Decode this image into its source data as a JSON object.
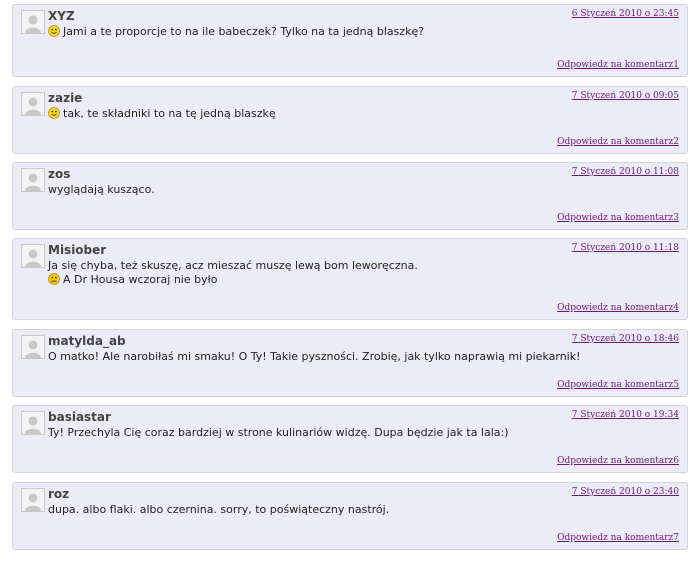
{
  "comments": [
    {
      "author": "XYZ",
      "date": "6 Styczeń 2010 o 23:45",
      "smiley1": "happy-smiley-icon",
      "line1": "Jami a te proporcje to na ile babeczek? Tylko na ta jedną blaszkę?",
      "line2": "",
      "reply": "Odpowiedz na komentarz1"
    },
    {
      "author": "zazie",
      "date": "7 Styczeń 2010 o 09:05",
      "smiley1": "happy-smiley-icon",
      "line1": "tak, te składniki to na tę jedną blaszkę",
      "line2": "",
      "reply": "Odpowiedz na komentarz2"
    },
    {
      "author": "zos",
      "date": "7 Styczeń 2010 o 11:08",
      "line1": "wyglądają kusząco.",
      "line2": "",
      "reply": "Odpowiedz na komentarz3"
    },
    {
      "author": "Misiober",
      "date": "7 Styczeń 2010 o 11:18",
      "line1": "Ja się chyba, też skuszę, acz mieszać muszę lewą bom leworęczna.",
      "smiley2": "sad-smiley-icon",
      "line2": "A Dr Housa wczoraj nie było",
      "reply": "Odpowiedz na komentarz4"
    },
    {
      "author": "matylda_ab",
      "date": "7 Styczeń 2010 o 18:46",
      "line1": "O matko! Ale narobiłaś mi smaku! O Ty! Takie pyszności. Zrobię, jak tylko naprawią mi piekarnik!",
      "line2": "",
      "reply": "Odpowiedz na komentarz5"
    },
    {
      "author": "basiastar",
      "date": "7 Styczeń 2010 o 19:34",
      "line1": "Ty! Przechyla Cię coraz bardziej w strone kulinariów widzę. Dupa będzie jak ta lala:)",
      "line2": "",
      "reply": "Odpowiedz na komentarz6"
    },
    {
      "author": "roz",
      "date": "7 Styczeń 2010 o 23:40",
      "line1": "dupa. albo flaki. albo czernina. sorry, to poświąteczny nastrój.",
      "line2": "",
      "reply": "Odpowiedz na komentarz7"
    }
  ],
  "colors": {
    "card_bg": "#ececf8",
    "link": "#6a1a74",
    "smiley_happy": "#f5d327",
    "smiley_sad": "#f5c518"
  }
}
